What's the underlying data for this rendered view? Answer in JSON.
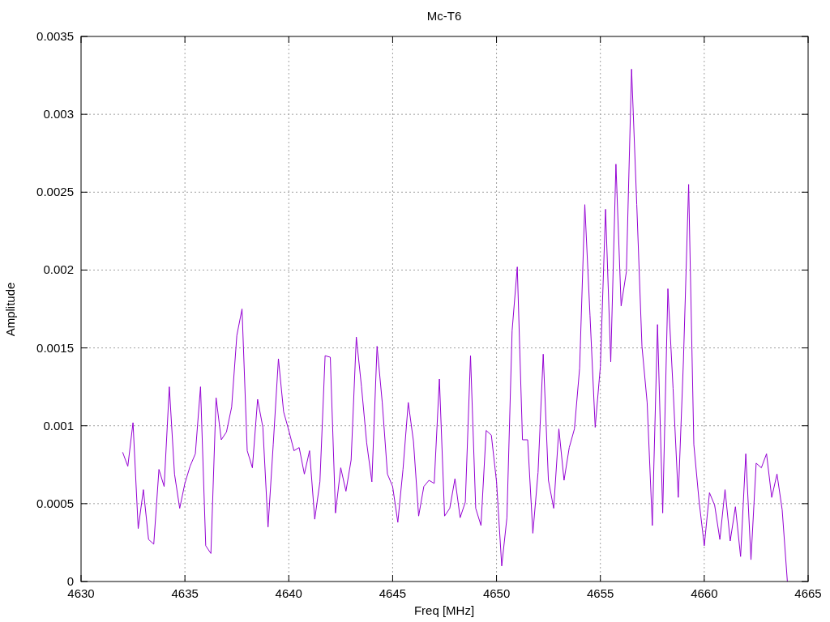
{
  "chart_data": {
    "type": "line",
    "title": "Mc-T6",
    "xlabel": "Freq [MHz]",
    "ylabel": "Amplitude",
    "x": [
      4632,
      4632.25,
      4632.5,
      4632.75,
      4633,
      4633.25,
      4633.5,
      4633.75,
      4634,
      4634.25,
      4634.5,
      4634.75,
      4635,
      4635.25,
      4635.5,
      4635.75,
      4636,
      4636.25,
      4636.5,
      4636.75,
      4637,
      4637.25,
      4637.5,
      4637.75,
      4638,
      4638.25,
      4638.5,
      4638.75,
      4639,
      4639.25,
      4639.5,
      4639.75,
      4640,
      4640.25,
      4640.5,
      4640.75,
      4641,
      4641.25,
      4641.5,
      4641.75,
      4642,
      4642.25,
      4642.5,
      4642.75,
      4643,
      4643.25,
      4643.5,
      4643.75,
      4644,
      4644.25,
      4644.5,
      4644.75,
      4645,
      4645.25,
      4645.5,
      4645.75,
      4646,
      4646.25,
      4646.5,
      4646.75,
      4647,
      4647.25,
      4647.5,
      4647.75,
      4648,
      4648.25,
      4648.5,
      4648.75,
      4649,
      4649.25,
      4649.5,
      4649.75,
      4650,
      4650.25,
      4650.5,
      4650.75,
      4651,
      4651.25,
      4651.5,
      4651.75,
      4652,
      4652.25,
      4652.5,
      4652.75,
      4653,
      4653.25,
      4653.5,
      4653.75,
      4654,
      4654.25,
      4654.5,
      4654.75,
      4655,
      4655.25,
      4655.5,
      4655.75,
      4656,
      4656.25,
      4656.5,
      4656.75,
      4657,
      4657.25,
      4657.5,
      4657.75,
      4658,
      4658.25,
      4658.5,
      4658.75,
      4659,
      4659.25,
      4659.5,
      4659.75,
      4660,
      4660.25,
      4660.5,
      4660.75,
      4661,
      4661.25,
      4661.5,
      4661.75,
      4662,
      4662.25,
      4662.5,
      4662.75,
      4663,
      4663.25,
      4663.5,
      4663.75,
      4664
    ],
    "series": [
      {
        "color": "#9400d3",
        "values": [
          0.00083,
          0.00074,
          0.00102,
          0.00034,
          0.00059,
          0.00027,
          0.00024,
          0.00072,
          0.00061,
          0.00125,
          0.00069,
          0.00047,
          0.00063,
          0.00074,
          0.00082,
          0.00125,
          0.00023,
          0.00018,
          0.00118,
          0.00091,
          0.00096,
          0.00112,
          0.00158,
          0.00175,
          0.00084,
          0.00073,
          0.00117,
          0.00099,
          0.00035,
          0.00088,
          0.00143,
          0.00109,
          0.00097,
          0.00084,
          0.00086,
          0.00069,
          0.00084,
          0.0004,
          0.00064,
          0.00145,
          0.00144,
          0.00044,
          0.00073,
          0.00058,
          0.00078,
          0.00157,
          0.00125,
          0.00089,
          0.00064,
          0.00151,
          0.00115,
          0.00069,
          0.00061,
          0.00038,
          0.00072,
          0.00115,
          0.0009,
          0.00042,
          0.00061,
          0.00065,
          0.00063,
          0.0013,
          0.00042,
          0.00047,
          0.00066,
          0.00041,
          0.00051,
          0.00145,
          0.00047,
          0.00036,
          0.00097,
          0.00094,
          0.00064,
          0.0001,
          0.00041,
          0.00161,
          0.00202,
          0.00091,
          0.00091,
          0.00031,
          0.0007,
          0.00146,
          0.00065,
          0.00047,
          0.00098,
          0.00065,
          0.00086,
          0.00098,
          0.00137,
          0.00242,
          0.00171,
          0.00099,
          0.00138,
          0.00239,
          0.00141,
          0.00268,
          0.00177,
          0.00199,
          0.00329,
          0.00242,
          0.00151,
          0.00115,
          0.00036,
          0.00165,
          0.00044,
          0.00188,
          0.00124,
          0.00054,
          0.00142,
          0.00255,
          0.00088,
          0.00052,
          0.00023,
          0.00057,
          0.00049,
          0.00027,
          0.00059,
          0.00026,
          0.00048,
          0.00016,
          0.00082,
          0.00014,
          0.00076,
          0.00073,
          0.00082,
          0.00054,
          0.00069,
          0.00046,
          0
        ]
      }
    ],
    "grid": true,
    "xlim": [
      4630,
      4665
    ],
    "ylim": [
      0,
      0.0035
    ],
    "xticks": [
      4630,
      4635,
      4640,
      4645,
      4650,
      4655,
      4660,
      4665
    ],
    "yticks": [
      0,
      0.0005,
      0.001,
      0.0015,
      0.002,
      0.0025,
      0.003,
      0.0035
    ]
  }
}
